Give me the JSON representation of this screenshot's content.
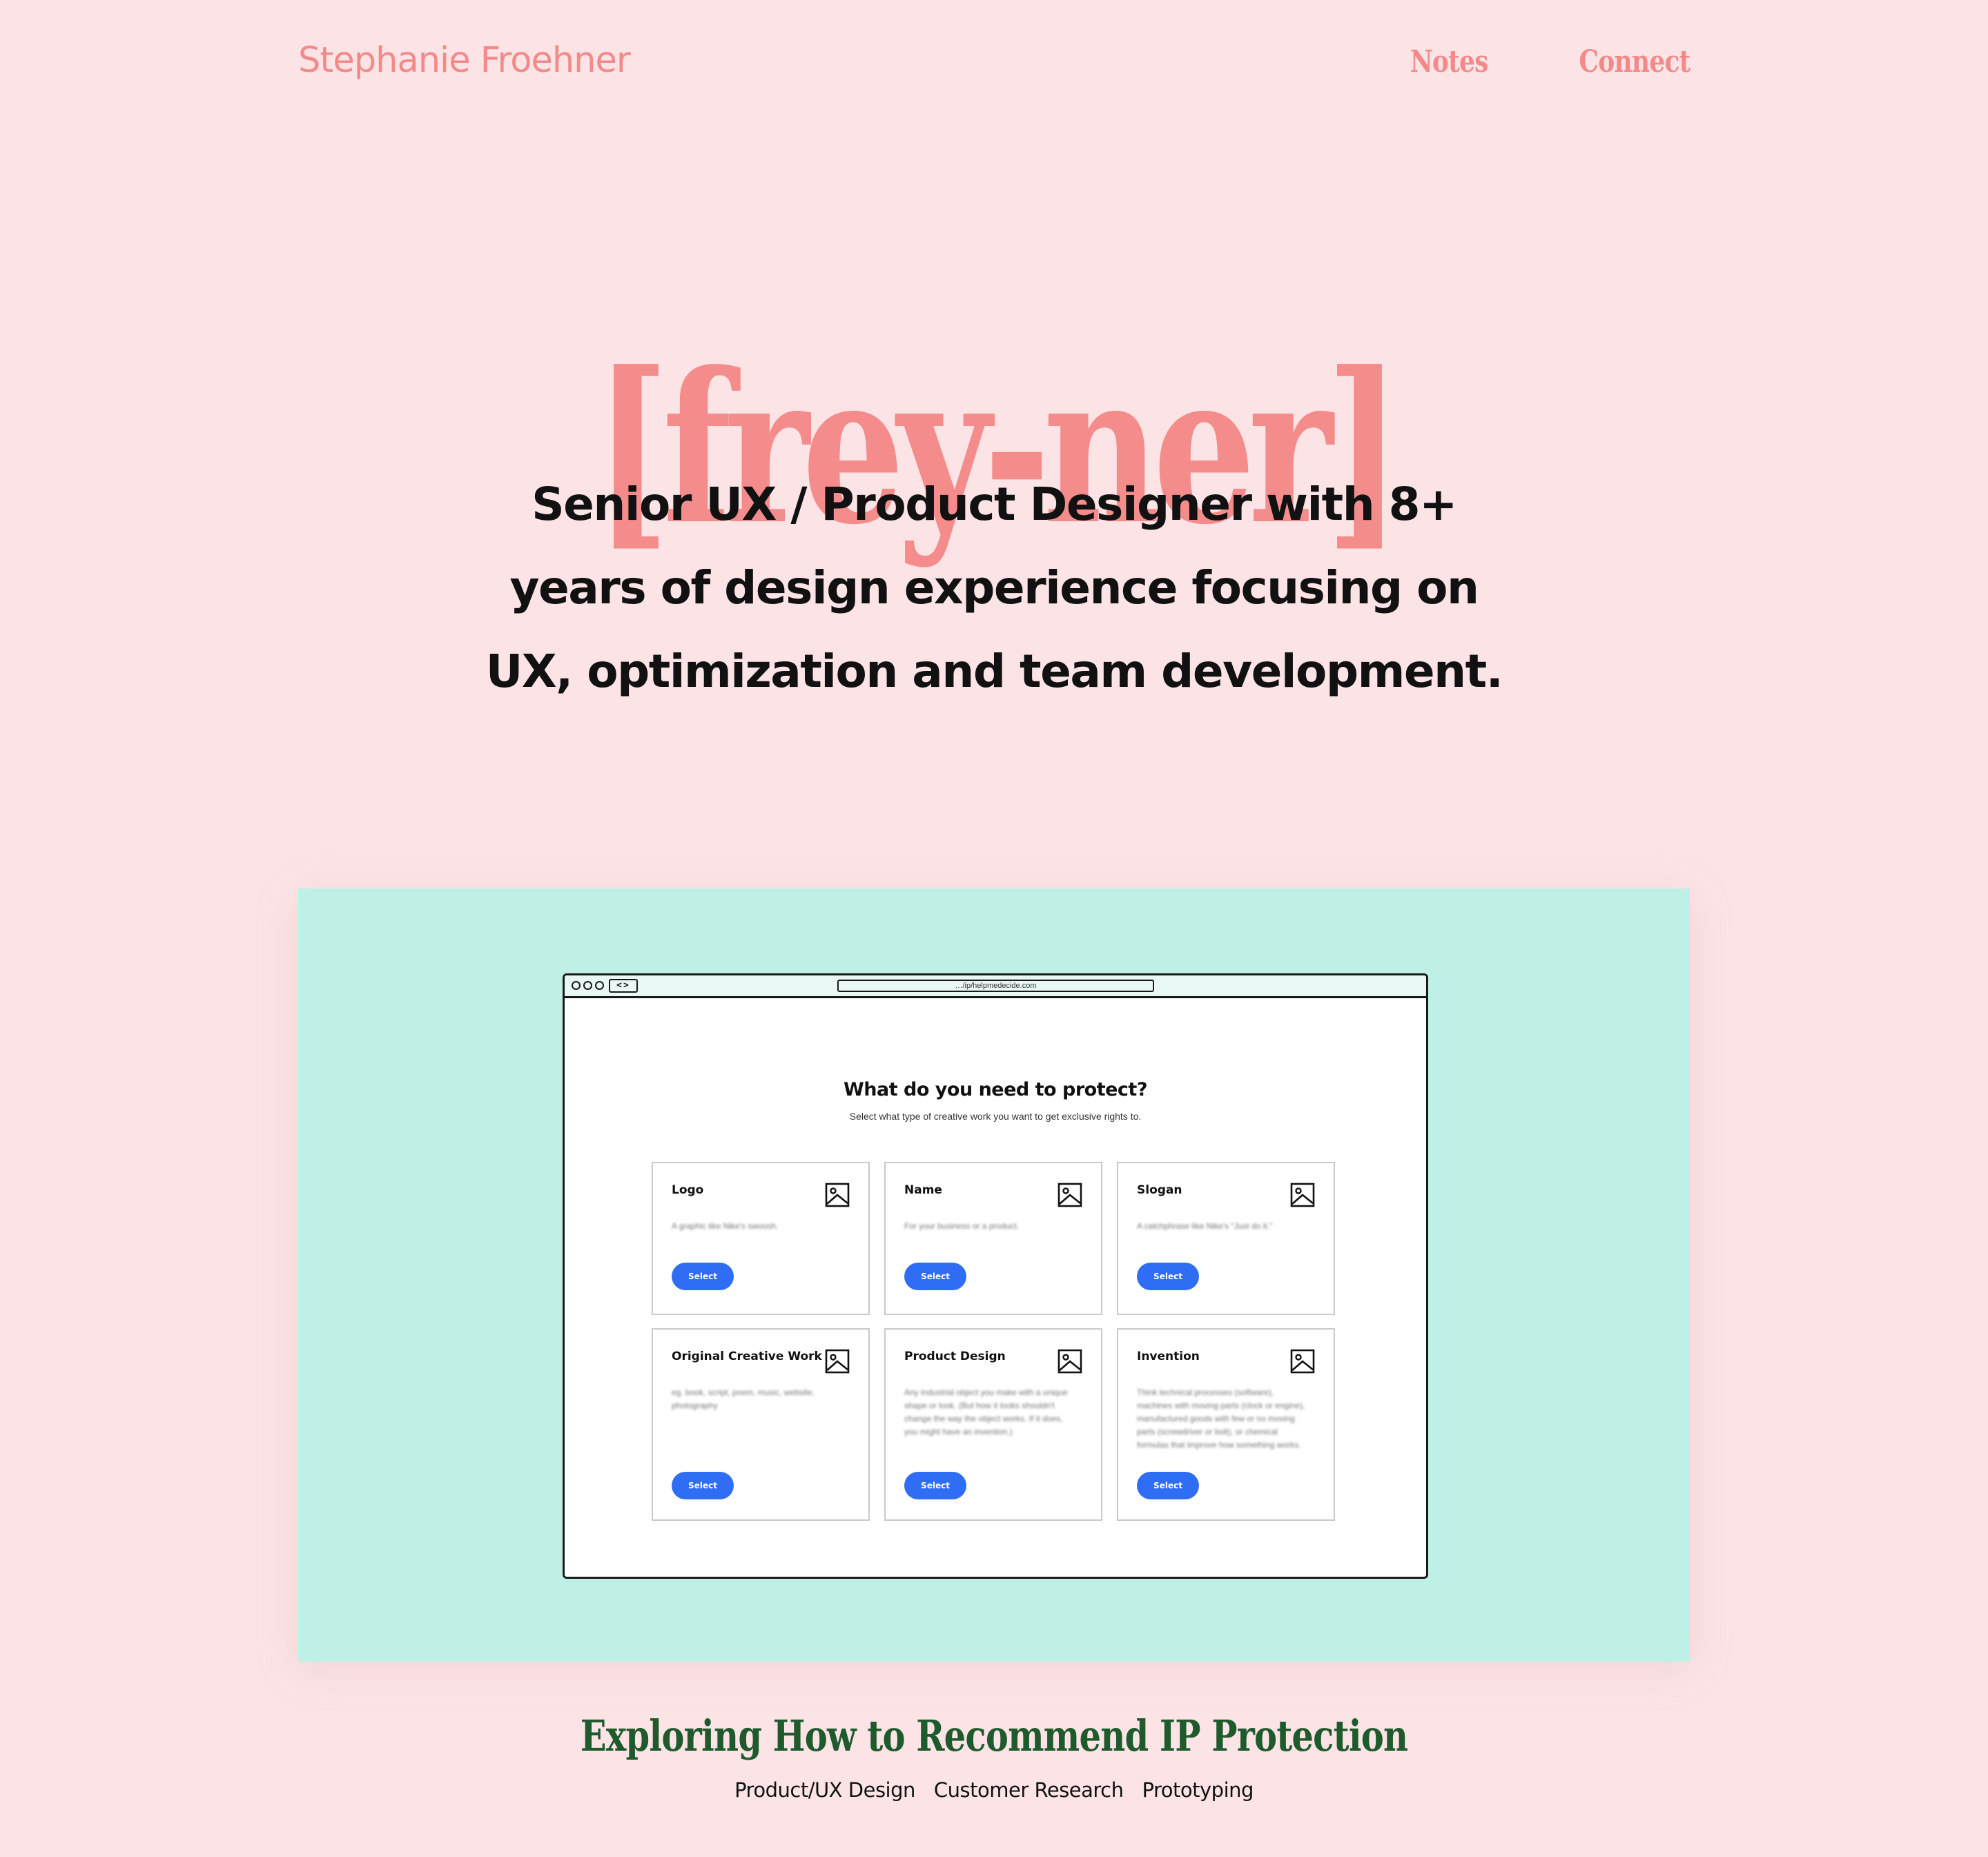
{
  "header": {
    "brand": "Stephanie Froehner",
    "nav": [
      {
        "label": "Notes"
      },
      {
        "label": "Connect"
      }
    ]
  },
  "hero": {
    "pronunciation": "[frey-ner]",
    "tagline": "Senior UX / Product Designer with 8+ years of design experience focusing on UX, optimization and team development."
  },
  "project": {
    "background_color": "#bef0e6",
    "mockup": {
      "url": "…/ip/helpmedecide.com",
      "title": "What do you need to protect?",
      "subtitle": "Select what type of creative work you want to get exclusive rights to.",
      "options": [
        {
          "title": "Logo",
          "description": "A graphic like Nike's swoosh.",
          "button": "Select",
          "icon": "image-icon"
        },
        {
          "title": "Name",
          "description": "For your business or a product.",
          "button": "Select",
          "icon": "image-icon"
        },
        {
          "title": "Slogan",
          "description": "A catchphrase like Nike's \"Just do it.\"",
          "button": "Select",
          "icon": "image-icon"
        },
        {
          "title": "Original Creative Work",
          "description": "eg. book, script, poem, music, website, photography",
          "button": "Select",
          "icon": "image-icon"
        },
        {
          "title": "Product Design",
          "description": "Any industrial object you make with a unique shape or look. (But how it looks shouldn't change the way the object works. If it does, you might have an invention.)",
          "button": "Select",
          "icon": "image-icon"
        },
        {
          "title": "Invention",
          "description": "Think technical processes (software), machines with moving parts (clock or engine), manufactured goods with few or no moving parts (screwdriver or bolt), or chemical formulas that improve how something works.",
          "button": "Select",
          "icon": "image-icon"
        }
      ],
      "button_color": "#2f6df5"
    },
    "title": "Exploring How to Recommend IP Protection",
    "tags": [
      "Product/UX Design",
      "Customer Research",
      "Prototyping"
    ]
  },
  "colors": {
    "page_background": "#fce4e6",
    "accent_pink": "#f28a8a",
    "title_green": "#1e5a2c"
  }
}
